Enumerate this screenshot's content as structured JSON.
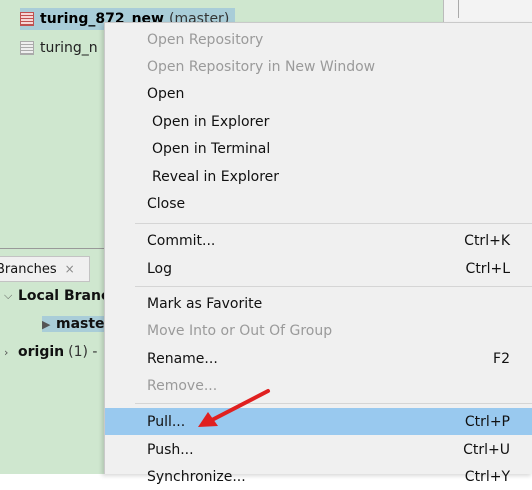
{
  "repositories": {
    "items": [
      {
        "name": "turing_872_new",
        "branch": "(master)"
      },
      {
        "name": "turing_n"
      }
    ]
  },
  "branches_panel": {
    "tab_label": "Branches",
    "tab_close": "×",
    "local_branches": "Local Branc",
    "master": "maste",
    "origin": "origin",
    "origin_count": "(1) -"
  },
  "context_menu": {
    "open_repository": "Open Repository",
    "open_repository_new_window": "Open Repository in New Window",
    "open": "Open",
    "open_in_explorer": "Open in Explorer",
    "open_in_terminal": "Open in Terminal",
    "reveal_in_explorer": "Reveal in Explorer",
    "close": "Close",
    "commit": "Commit...",
    "commit_shortcut": "Ctrl+K",
    "log": "Log",
    "log_shortcut": "Ctrl+L",
    "mark_as_favorite": "Mark as Favorite",
    "move_into_group": "Move Into or Out Of Group",
    "rename": "Rename...",
    "rename_shortcut": "F2",
    "remove": "Remove...",
    "pull": "Pull...",
    "pull_shortcut": "Ctrl+P",
    "push": "Push...",
    "push_shortcut": "Ctrl+U",
    "next_partial": "Synchronize...",
    "next_shortcut": "Ctrl+Y"
  },
  "colors": {
    "highlight": "#99c9ef",
    "annotation_arrow": "#e02020",
    "panel_green": "#cfe7cf"
  }
}
